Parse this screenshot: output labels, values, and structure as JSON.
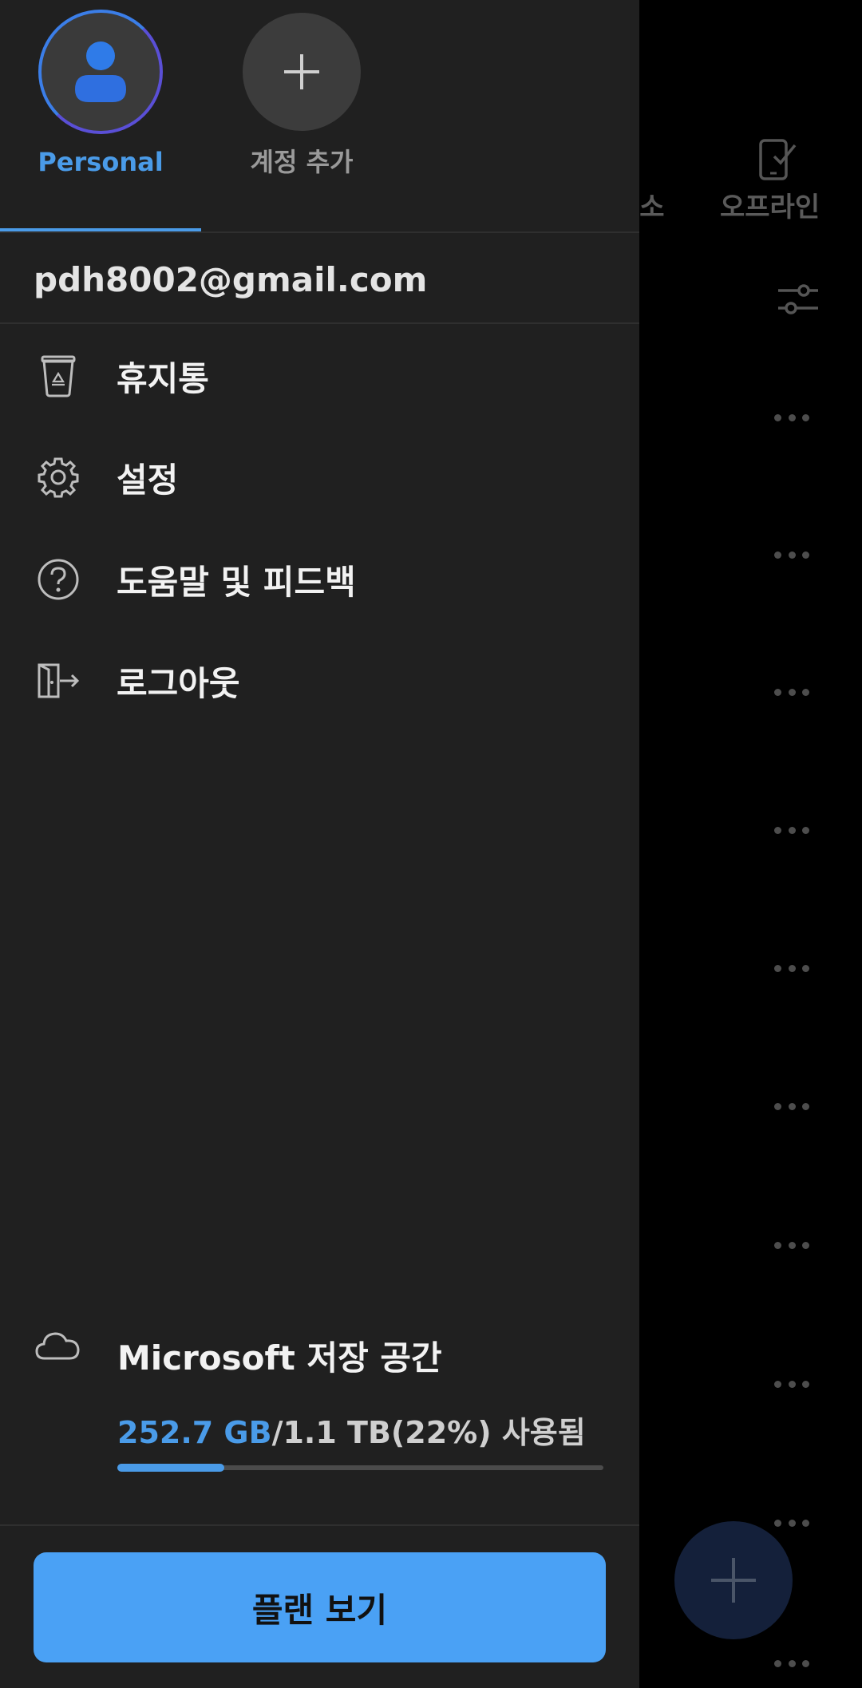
{
  "background": {
    "tabs": [
      {
        "label": "관소"
      },
      {
        "label": "오프라인"
      }
    ],
    "offline_icon": "phone-check-icon",
    "filter_icon": "filter-sliders-icon",
    "more_icon": "more-horizontal-icon",
    "fab_icon": "plus-icon"
  },
  "drawer": {
    "accounts": [
      {
        "label": "Personal",
        "icon": "person-icon",
        "active": true
      },
      {
        "label": "계정 추가",
        "icon": "plus-icon",
        "active": false
      }
    ],
    "email": "pdh8002@gmail.com",
    "menu": [
      {
        "label": "휴지통",
        "icon": "recycle-bin-icon"
      },
      {
        "label": "설정",
        "icon": "gear-icon"
      },
      {
        "label": "도움말 및 피드백",
        "icon": "help-circle-icon"
      },
      {
        "label": "로그아웃",
        "icon": "sign-out-icon"
      }
    ],
    "storage": {
      "icon": "cloud-icon",
      "title": "Microsoft 저장 공간",
      "used": "252.7 GB",
      "rest": "/1.1 TB(22%) 사용됨",
      "fraction": 0.22
    },
    "plan_button": "플랜 보기"
  },
  "colors": {
    "accent": "#4a9be8",
    "button": "#4aa1f5",
    "drawer_bg": "#202020"
  }
}
